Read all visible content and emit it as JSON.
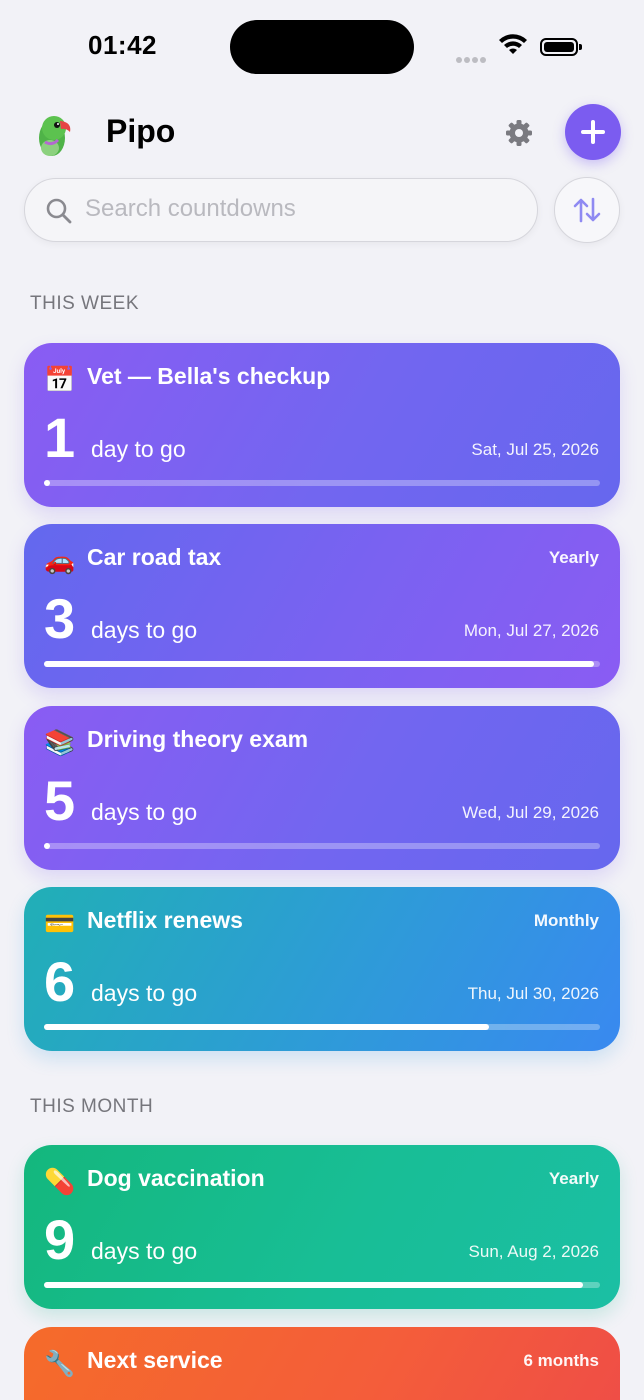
{
  "status_bar": {
    "time": "01:42"
  },
  "header": {
    "app_name": "Pipo"
  },
  "search": {
    "placeholder": "Search countdowns",
    "value": ""
  },
  "sections": [
    {
      "label": "THIS WEEK",
      "items": [
        {
          "emoji": "📅",
          "icon": "calendar-icon",
          "title": "Vet — Bella's checkup",
          "repeat": "",
          "count": "1",
          "unit": "day to go",
          "date": "Sat, Jul 25, 2026",
          "progress": 0.01,
          "color": "#7A62F1"
        },
        {
          "emoji": "🚗",
          "icon": "car-icon",
          "title": "Car road tax",
          "repeat": "Yearly",
          "count": "3",
          "unit": "days to go",
          "date": "Mon, Jul 27, 2026",
          "progress": 0.99,
          "color": "#7266F0"
        },
        {
          "emoji": "📚",
          "icon": "books-icon",
          "title": "Driving theory exam",
          "repeat": "",
          "count": "5",
          "unit": "days to go",
          "date": "Wed, Jul 29, 2026",
          "progress": 0.01,
          "color": "#7A62F1"
        },
        {
          "emoji": "💳",
          "icon": "credit-card-icon",
          "title": "Netflix renews",
          "repeat": "Monthly",
          "count": "6",
          "unit": "days to go",
          "date": "Thu, Jul 30, 2026",
          "progress": 0.8,
          "color": "#2E9BD8"
        }
      ]
    },
    {
      "label": "THIS MONTH",
      "items": [
        {
          "emoji": "💊",
          "icon": "pill-icon",
          "title": "Dog vaccination",
          "repeat": "Yearly",
          "count": "9",
          "unit": "days to go",
          "date": "Sun, Aug 2, 2026",
          "progress": 0.97,
          "color": "#18BE96"
        },
        {
          "emoji": "🔧",
          "icon": "wrench-icon",
          "title": "Next service",
          "repeat": "6 months",
          "count": "",
          "unit": "",
          "date": "",
          "progress": null,
          "color": "#F45D3A"
        }
      ]
    }
  ]
}
